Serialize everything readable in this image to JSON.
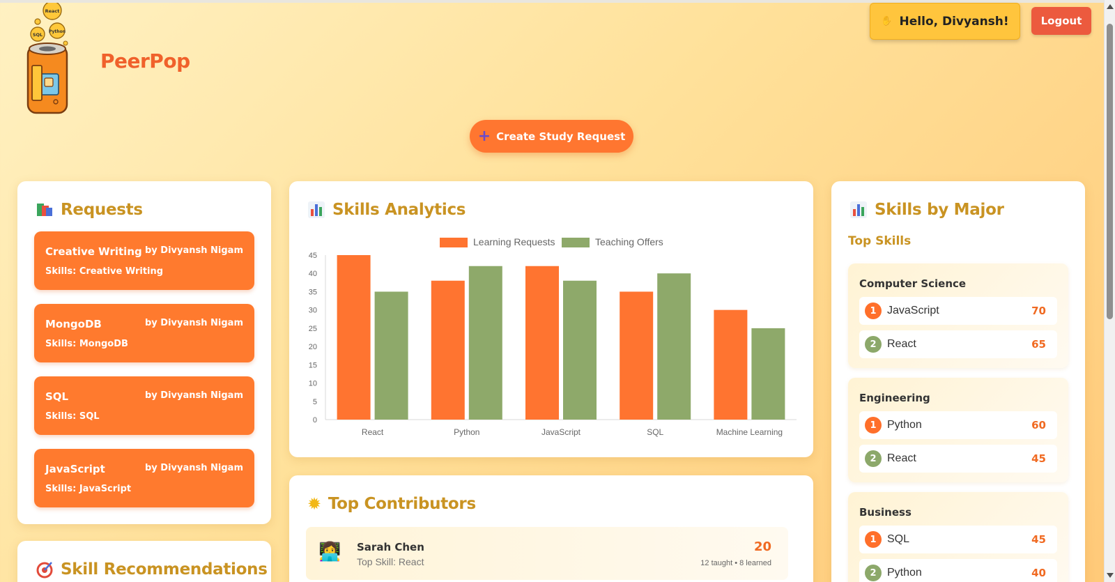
{
  "header": {
    "brand": "PeerPop",
    "logo_bubbles": [
      "React",
      "SQL",
      "Python"
    ],
    "greeting": "Hello, Divyansh!",
    "logout": "Logout",
    "create_request": "Create Study Request"
  },
  "requests": {
    "title": "Requests",
    "items": [
      {
        "title": "Creative Writing",
        "by": "by Divyansh Nigam",
        "skills": "Skills: Creative Writing"
      },
      {
        "title": "MongoDB",
        "by": "by Divyansh Nigam",
        "skills": "Skills: MongoDB"
      },
      {
        "title": "SQL",
        "by": "by Divyansh Nigam",
        "skills": "Skills: SQL"
      },
      {
        "title": "JavaScript",
        "by": "by Divyansh Nigam",
        "skills": "Skills: JavaScript"
      }
    ]
  },
  "recommendations": {
    "title": "Skill Recommendations"
  },
  "analytics": {
    "title": "Skills Analytics"
  },
  "chart_data": {
    "type": "bar",
    "title": "",
    "xlabel": "",
    "ylabel": "",
    "categories": [
      "React",
      "Python",
      "JavaScript",
      "SQL",
      "Machine Learning"
    ],
    "series": [
      {
        "name": "Learning Requests",
        "values": [
          45,
          38,
          42,
          35,
          30
        ],
        "color": "#ff7430"
      },
      {
        "name": "Teaching Offers",
        "values": [
          35,
          42,
          38,
          40,
          25
        ],
        "color": "#8ea96a"
      }
    ],
    "ylim": [
      0,
      45
    ],
    "yticks": [
      0,
      5,
      10,
      15,
      20,
      25,
      30,
      35,
      40,
      45
    ],
    "legend": "top-center",
    "grid": false
  },
  "contributors": {
    "title": "Top Contributors",
    "items": [
      {
        "name": "Sarah Chen",
        "top_skill": "Top Skill: React",
        "score": "20",
        "detail": "12 taught • 8 learned",
        "avatar": "👩‍💻"
      }
    ]
  },
  "majors": {
    "title": "Skills by Major",
    "subtitle": "Top Skills",
    "groups": [
      {
        "name": "Computer Science",
        "skills": [
          {
            "rank": "1",
            "name": "JavaScript",
            "count": "70"
          },
          {
            "rank": "2",
            "name": "React",
            "count": "65"
          }
        ]
      },
      {
        "name": "Engineering",
        "skills": [
          {
            "rank": "1",
            "name": "Python",
            "count": "60"
          },
          {
            "rank": "2",
            "name": "React",
            "count": "45"
          }
        ]
      },
      {
        "name": "Business",
        "skills": [
          {
            "rank": "1",
            "name": "SQL",
            "count": "45"
          },
          {
            "rank": "2",
            "name": "Python",
            "count": "40"
          }
        ]
      }
    ]
  },
  "colors": {
    "accent": "#ff7630",
    "title": "#c99322",
    "brand": "#f0612b",
    "logout": "#ec5a3e",
    "greeting": "#ffc53d"
  }
}
